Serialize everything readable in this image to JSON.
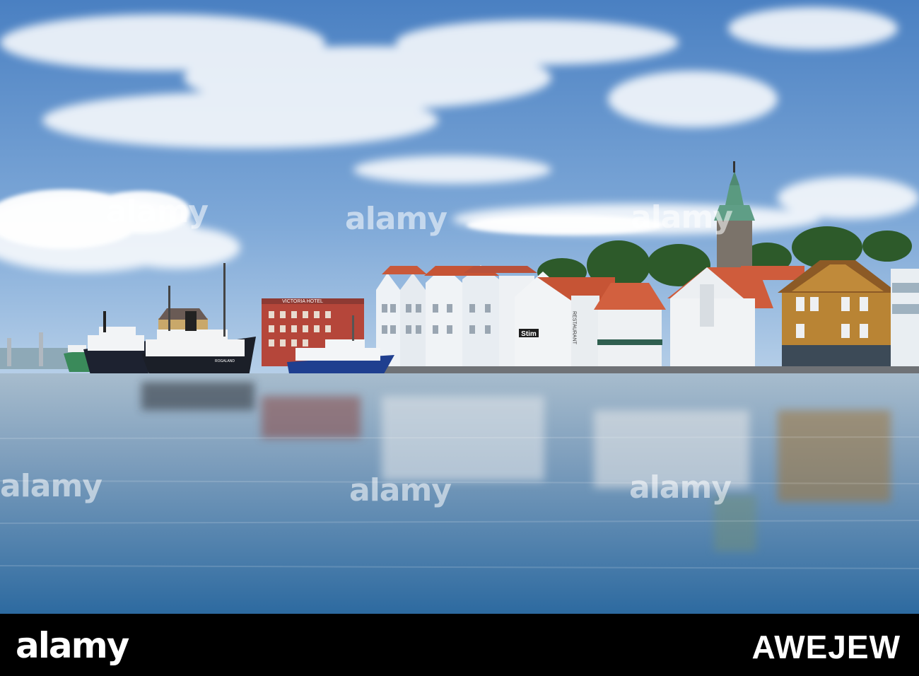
{
  "scene": {
    "hotel_sign": "VICTORIA HOTEL",
    "shop_sign": "Stim",
    "restaurant_sign": "RESTAURANT",
    "ship_name": "ROGALAND",
    "colors": {
      "sky_top": "#4f86c6",
      "sky_bottom": "#a9c8e6",
      "water_top": "#9fb6c9",
      "water_bottom": "#2f6ea3",
      "roof_orange": "#c9593a",
      "tower_green": "#5a9a80",
      "ferry_blue": "#1f3f8f"
    }
  },
  "watermarks": [
    "alamy",
    "alamy",
    "alamy",
    "alamy",
    "alamy",
    "alamy"
  ],
  "footer": {
    "logo": "alamy",
    "image_id": "AWEJEW"
  }
}
